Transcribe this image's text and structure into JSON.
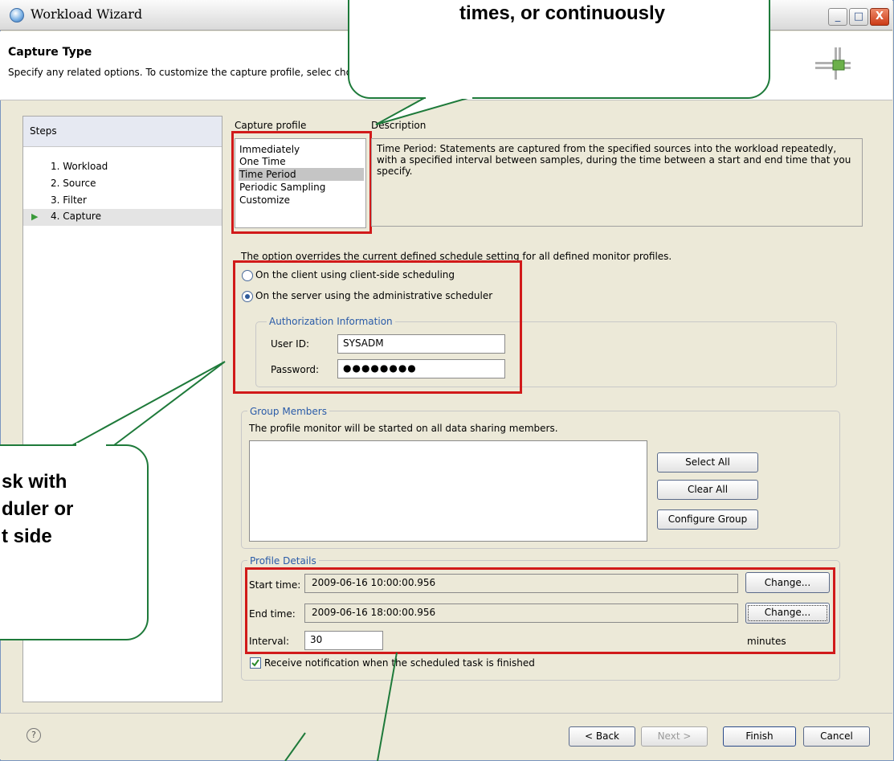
{
  "window": {
    "title": "Workload Wizard",
    "controls": [
      "_",
      "□",
      "X"
    ]
  },
  "header": {
    "title": "Capture Type",
    "description": "Specify any related options. To customize the capture profile, selec choose from more options."
  },
  "steps": {
    "heading": "Steps",
    "items": [
      "1. Workload",
      "2. Source",
      "3. Filter",
      "4. Capture"
    ],
    "current_index": 3
  },
  "capture_profile": {
    "label": "Capture profile",
    "options": [
      "Immediately",
      "One Time",
      "Time Period",
      "Periodic Sampling",
      "Customize"
    ],
    "selected": "Time Period"
  },
  "description": {
    "label": "Description",
    "text": "Time Period: Statements are captured from the specified sources into the workload repeatedly, with a specified interval between samples, during the time between a start and end time that you specify."
  },
  "scheduling": {
    "note": "The option overrides the current defined schedule setting for all defined monitor profiles.",
    "option_client": "On the client using client-side scheduling",
    "option_server": "On the server using the administrative scheduler",
    "selected": "server"
  },
  "authorization": {
    "legend": "Authorization Information",
    "user_label": "User ID:",
    "user_value": "SYSADM",
    "password_label": "Password:",
    "password_value": "●●●●●●●●"
  },
  "group_members": {
    "legend": "Group Members",
    "note": "The profile monitor will be started on all data sharing members.",
    "select_all": "Select All",
    "clear_all": "Clear All",
    "configure_group": "Configure Group"
  },
  "profile_details": {
    "legend": "Profile Details",
    "start_label": "Start time:",
    "start_value": "2009-06-16 10:00:00.956",
    "end_label": "End time:",
    "end_value": "2009-06-16 18:00:00.956",
    "change_label": "Change...",
    "interval_label": "Interval:",
    "interval_value": "30",
    "interval_unit": "minutes",
    "notify_label": "Receive notification when the scheduled task is finished",
    "notify_checked": true
  },
  "buttons": {
    "back": "< Back",
    "next": "Next >",
    "finish": "Finish",
    "cancel": "Cancel",
    "help": "?"
  },
  "callouts": {
    "top": "times, or continuously",
    "left": [
      "sk with",
      "duler or",
      "t side"
    ]
  }
}
